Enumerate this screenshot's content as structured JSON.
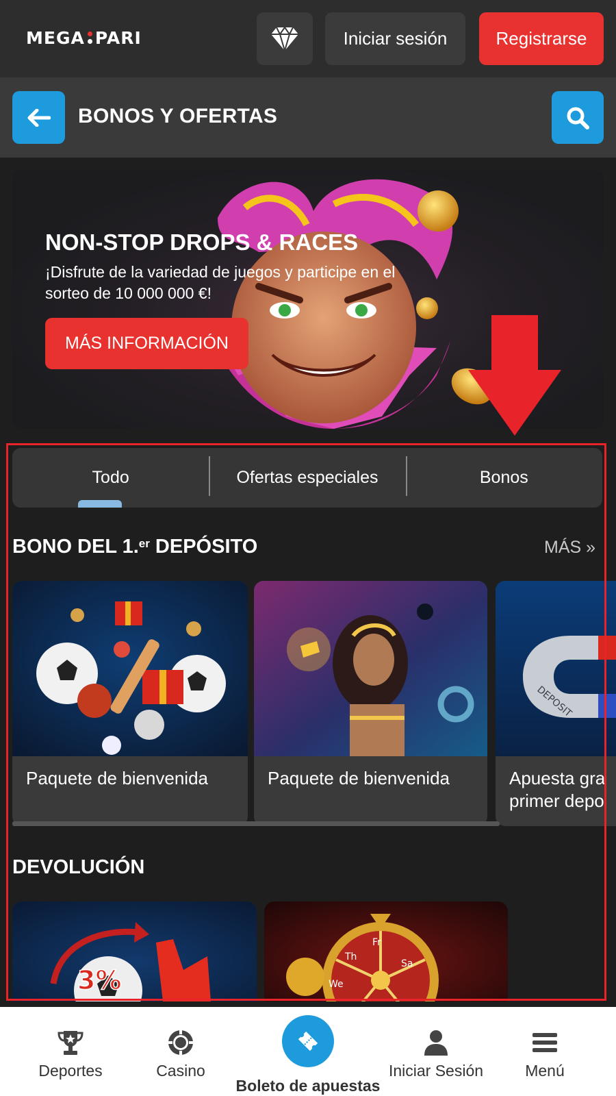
{
  "header": {
    "logo_left": "MEGA",
    "logo_right": "PARI",
    "login_label": "Iniciar sesión",
    "register_label": "Registrarse"
  },
  "subheader": {
    "title": "BONOS Y OFERTAS"
  },
  "banner": {
    "title": "NON-STOP DROPS & RACES",
    "text": "¡Disfrute de la variedad de juegos y participe en el sorteo de 10 000 000 €!",
    "cta": "MÁS INFORMACIÓN"
  },
  "tabs": [
    {
      "label": "Todo",
      "active": true
    },
    {
      "label": "Ofertas especiales",
      "active": false
    },
    {
      "label": "Bonos",
      "active": false
    }
  ],
  "sections": {
    "first_deposit": {
      "title_pre": "BONO DEL 1.",
      "title_sup": "er",
      "title_post": " DEPÓSITO",
      "more": "MÁS »",
      "cards": [
        {
          "label": "Paquete de bienvenida"
        },
        {
          "label": "Paquete de bienvenida"
        },
        {
          "label": "Apuesta gra",
          "label2": "primer depo"
        }
      ]
    },
    "cashback": {
      "title": "DEVOLUCIÓN"
    }
  },
  "bottom_nav": {
    "sports": "Deportes",
    "casino": "Casino",
    "betslip": "Boleto de apuestas",
    "login": "Iniciar Sesión",
    "menu": "Menú"
  },
  "colors": {
    "accent_blue": "#1e9bdc",
    "accent_red": "#e8322f",
    "background": "#1e1e1e",
    "tab_indicator": "#87b9e2"
  },
  "icons": [
    "diamond-icon",
    "arrow-left-icon",
    "search-icon",
    "trophy-icon",
    "casino-chip-icon",
    "ticket-icon",
    "user-icon",
    "hamburger-icon"
  ]
}
